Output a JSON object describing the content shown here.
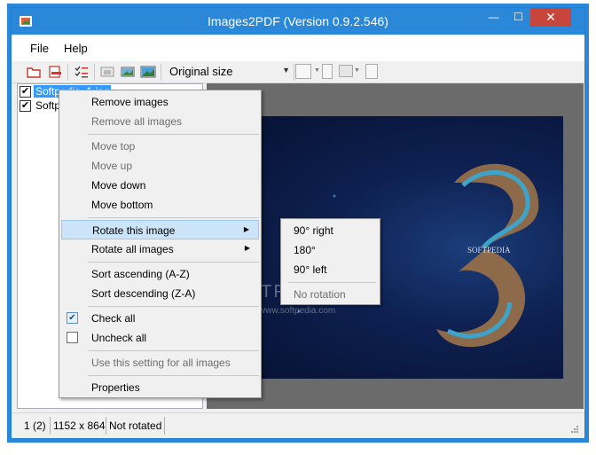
{
  "window": {
    "title": "Images2PDF (Version 0.9.2.546)",
    "controls": {
      "minimize": "—",
      "maximize": "☐",
      "close": "✕"
    }
  },
  "menubar": {
    "items": [
      "File",
      "Help"
    ]
  },
  "toolbar": {
    "icons": [
      "open-folder-icon",
      "remove-image-icon",
      "check-list-icon",
      "image-small-icon",
      "image-fit-icon",
      "image-large-icon"
    ],
    "size_dropdown": {
      "value": "Original size"
    }
  },
  "sidebar": {
    "items": [
      {
        "label": "Softpedia_1.jpg",
        "checked": true,
        "selected": true
      },
      {
        "label": "Softpe",
        "checked": true,
        "selected": false
      }
    ]
  },
  "preview": {
    "watermark": "SOFTPEDIA",
    "watermark_url": "www.softpedia.com",
    "image_caption": "SOFTPEDIA"
  },
  "statusbar": {
    "index": "1 (2)",
    "dimensions": "1152 x 864",
    "rotation": "Not rotated"
  },
  "context_menu": {
    "items": [
      {
        "label": "Remove images",
        "enabled": true
      },
      {
        "label": "Remove all images",
        "enabled": false
      },
      {
        "label": "Move top",
        "enabled": false
      },
      {
        "label": "Move up",
        "enabled": false
      },
      {
        "label": "Move down",
        "enabled": true
      },
      {
        "label": "Move bottom",
        "enabled": true
      },
      {
        "label": "Rotate this image",
        "enabled": true,
        "submenu": true,
        "highlighted": true
      },
      {
        "label": "Rotate all images",
        "enabled": true,
        "submenu": true
      },
      {
        "label": "Sort ascending (A-Z)",
        "enabled": true
      },
      {
        "label": "Sort descending (Z-A)",
        "enabled": true
      },
      {
        "label": "Check all",
        "enabled": true,
        "checked": true
      },
      {
        "label": "Uncheck all",
        "enabled": true,
        "checked": false
      },
      {
        "label": "Use this setting for all images",
        "enabled": false
      },
      {
        "label": "Properties",
        "enabled": true
      }
    ]
  },
  "rotate_submenu": {
    "items": [
      {
        "label": "90° right",
        "enabled": true
      },
      {
        "label": "180°",
        "enabled": true
      },
      {
        "label": "90° left",
        "enabled": true
      },
      {
        "label": "No rotation",
        "enabled": false
      }
    ]
  },
  "colors": {
    "titlebar": "#2b88d8",
    "close_button": "#c7453b",
    "selection": "#3399ff",
    "menu_highlight": "#cce4f7"
  }
}
